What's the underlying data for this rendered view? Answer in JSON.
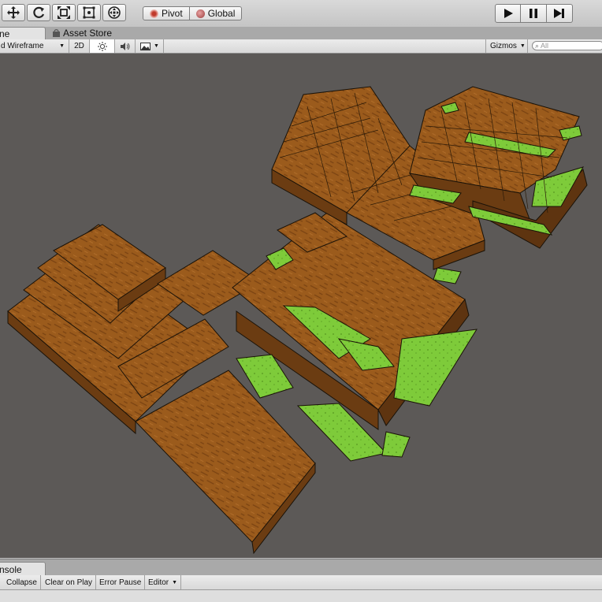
{
  "toolbar": {
    "tools": [
      {
        "name": "move-tool-button",
        "icon": "move-icon"
      },
      {
        "name": "rotate-tool-button",
        "icon": "rotate-icon"
      },
      {
        "name": "scale-tool-button",
        "icon": "scale-icon"
      },
      {
        "name": "rect-tool-button",
        "icon": "rect-icon"
      },
      {
        "name": "transform-tool-button",
        "icon": "transform-icon"
      }
    ],
    "pivot_label": "Pivot",
    "global_label": "Global",
    "play_icon": "play-icon",
    "pause_icon": "pause-icon",
    "step_icon": "step-icon"
  },
  "tabs": {
    "scene_label": "ne",
    "asset_store_label": "Asset Store"
  },
  "scene_toolbar": {
    "draw_mode": "d Wireframe",
    "mode_2d": "2D",
    "lighting_icon": "sun-icon",
    "audio_icon": "speaker-icon",
    "effects_icon": "image-icon",
    "gizmos_label": "Gizmos",
    "search_placeholder": "All"
  },
  "console": {
    "tab_label": "nsole",
    "collapse_label": "Collapse",
    "clear_on_play_label": "Clear on Play",
    "error_pause_label": "Error Pause",
    "editor_label": "Editor"
  },
  "colors": {
    "viewport_bg": "#5c5957",
    "dirt": "#9a5a1a",
    "grass": "#7ecb3a"
  }
}
